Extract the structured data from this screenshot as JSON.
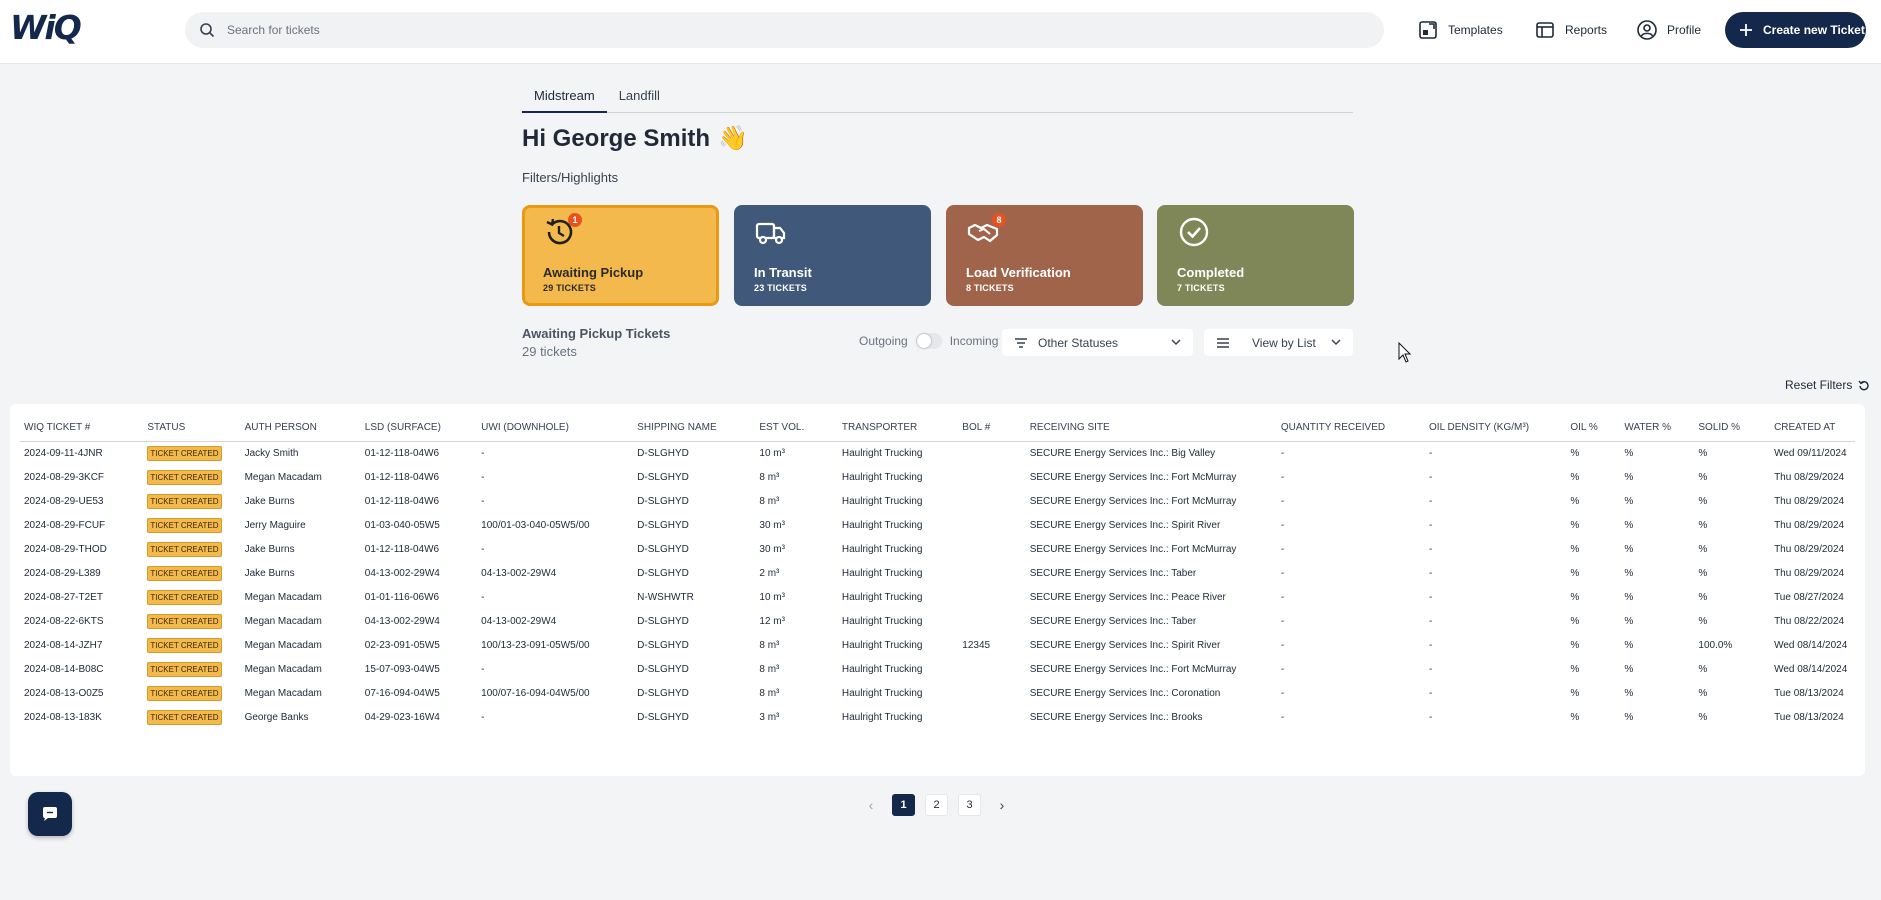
{
  "app": {
    "logo": "WiQ"
  },
  "search": {
    "placeholder": "Search for tickets"
  },
  "nav": {
    "templates": "Templates",
    "reports": "Reports",
    "profile": "Profile",
    "create": "Create new Ticket"
  },
  "tabs": [
    {
      "label": "Midstream",
      "active": true
    },
    {
      "label": "Landfill",
      "active": false
    }
  ],
  "greeting": {
    "text": "Hi George Smith",
    "emoji": "👋"
  },
  "filters_title": "Filters/Highlights",
  "cards": [
    {
      "label": "Awaiting Pickup",
      "count": "29 TICKETS",
      "badge": "1",
      "icon": "clock-history-icon",
      "color": "#f4b94c"
    },
    {
      "label": "In Transit",
      "count": "23 TICKETS",
      "badge": "",
      "icon": "truck-icon",
      "color": "#40597a"
    },
    {
      "label": "Load Verification",
      "count": "8 TICKETS",
      "badge": "8",
      "icon": "handshake-icon",
      "color": "#a0644b"
    },
    {
      "label": "Completed",
      "count": "7 TICKETS",
      "badge": "",
      "icon": "check-circle-icon",
      "color": "#7f8657"
    }
  ],
  "section": {
    "title": "Awaiting Pickup Tickets",
    "subtitle": "29 tickets"
  },
  "toggle": {
    "left": "Outgoing",
    "right": "Incoming"
  },
  "status_dropdown": {
    "value": "Other Statuses"
  },
  "view_dropdown": {
    "value": "View by List"
  },
  "reset_filters": "Reset Filters",
  "table": {
    "columns": [
      "WIQ TICKET #",
      "STATUS",
      "AUTH PERSON",
      "LSD (SURFACE)",
      "UWI (DOWNHOLE)",
      "SHIPPING NAME",
      "EST VOL.",
      "TRANSPORTER",
      "BOL #",
      "RECEIVING SITE",
      "QUANTITY RECEIVED",
      "OIL DENSITY (KG/M³)",
      "OIL %",
      "WATER %",
      "SOLID %",
      "CREATED AT"
    ],
    "rows": [
      [
        "2024-09-11-4JNR",
        "TICKET CREATED",
        "Jacky Smith",
        "01-12-118-04W6",
        "-",
        "D-SLGHYD",
        "10 m³",
        "Haulright Trucking",
        "",
        "SECURE Energy Services Inc.: Big Valley",
        "-",
        "-",
        "%",
        "%",
        "%",
        "Wed 09/11/2024"
      ],
      [
        "2024-08-29-3KCF",
        "TICKET CREATED",
        "Megan Macadam",
        "01-12-118-04W6",
        "-",
        "D-SLGHYD",
        "8 m³",
        "Haulright Trucking",
        "",
        "SECURE Energy Services Inc.: Fort McMurray",
        "-",
        "-",
        "%",
        "%",
        "%",
        "Thu 08/29/2024"
      ],
      [
        "2024-08-29-UE53",
        "TICKET CREATED",
        "Jake Burns",
        "01-12-118-04W6",
        "-",
        "D-SLGHYD",
        "8 m³",
        "Haulright Trucking",
        "",
        "SECURE Energy Services Inc.: Fort McMurray",
        "-",
        "-",
        "%",
        "%",
        "%",
        "Thu 08/29/2024"
      ],
      [
        "2024-08-29-FCUF",
        "TICKET CREATED",
        "Jerry Maguire",
        "01-03-040-05W5",
        "100/01-03-040-05W5/00",
        "D-SLGHYD",
        "30 m³",
        "Haulright Trucking",
        "",
        "SECURE Energy Services Inc.: Spirit River",
        "-",
        "-",
        "%",
        "%",
        "%",
        "Thu 08/29/2024"
      ],
      [
        "2024-08-29-THOD",
        "TICKET CREATED",
        "Jake Burns",
        "01-12-118-04W6",
        "-",
        "D-SLGHYD",
        "30 m³",
        "Haulright Trucking",
        "",
        "SECURE Energy Services Inc.: Fort McMurray",
        "-",
        "-",
        "%",
        "%",
        "%",
        "Thu 08/29/2024"
      ],
      [
        "2024-08-29-L389",
        "TICKET CREATED",
        "Jake Burns",
        "04-13-002-29W4",
        "04-13-002-29W4",
        "D-SLGHYD",
        "2 m³",
        "Haulright Trucking",
        "",
        "SECURE Energy Services Inc.: Taber",
        "-",
        "-",
        "%",
        "%",
        "%",
        "Thu 08/29/2024"
      ],
      [
        "2024-08-27-T2ET",
        "TICKET CREATED",
        "Megan Macadam",
        "01-01-116-06W6",
        "-",
        "N-WSHWTR",
        "10 m³",
        "Haulright Trucking",
        "",
        "SECURE Energy Services Inc.: Peace River",
        "-",
        "-",
        "%",
        "%",
        "%",
        "Tue 08/27/2024"
      ],
      [
        "2024-08-22-6KTS",
        "TICKET CREATED",
        "Megan Macadam",
        "04-13-002-29W4",
        "04-13-002-29W4",
        "D-SLGHYD",
        "12 m³",
        "Haulright Trucking",
        "",
        "SECURE Energy Services Inc.: Taber",
        "-",
        "-",
        "%",
        "%",
        "%",
        "Thu 08/22/2024"
      ],
      [
        "2024-08-14-JZH7",
        "TICKET CREATED",
        "Megan Macadam",
        "02-23-091-05W5",
        "100/13-23-091-05W5/00",
        "D-SLGHYD",
        "8 m³",
        "Haulright Trucking",
        "12345",
        "SECURE Energy Services Inc.: Spirit River",
        "-",
        "-",
        "%",
        "%",
        "100.0%",
        "Wed 08/14/2024"
      ],
      [
        "2024-08-14-B08C",
        "TICKET CREATED",
        "Megan Macadam",
        "15-07-093-04W5",
        "-",
        "D-SLGHYD",
        "8 m³",
        "Haulright Trucking",
        "",
        "SECURE Energy Services Inc.: Fort McMurray",
        "-",
        "-",
        "%",
        "%",
        "%",
        "Wed 08/14/2024"
      ],
      [
        "2024-08-13-O0Z5",
        "TICKET CREATED",
        "Megan Macadam",
        "07-16-094-04W5",
        "100/07-16-094-04W5/00",
        "D-SLGHYD",
        "8 m³",
        "Haulright Trucking",
        "",
        "SECURE Energy Services Inc.: Coronation",
        "-",
        "-",
        "%",
        "%",
        "%",
        "Tue 08/13/2024"
      ],
      [
        "2024-08-13-183K",
        "TICKET CREATED",
        "George Banks",
        "04-29-023-16W4",
        "-",
        "D-SLGHYD",
        "3 m³",
        "Haulright Trucking",
        "",
        "SECURE Energy Services Inc.: Brooks",
        "-",
        "-",
        "%",
        "%",
        "%",
        "Tue 08/13/2024"
      ]
    ]
  },
  "pagination": {
    "prev": "‹",
    "pages": [
      "1",
      "2",
      "3"
    ],
    "current": "1",
    "next": "›"
  }
}
